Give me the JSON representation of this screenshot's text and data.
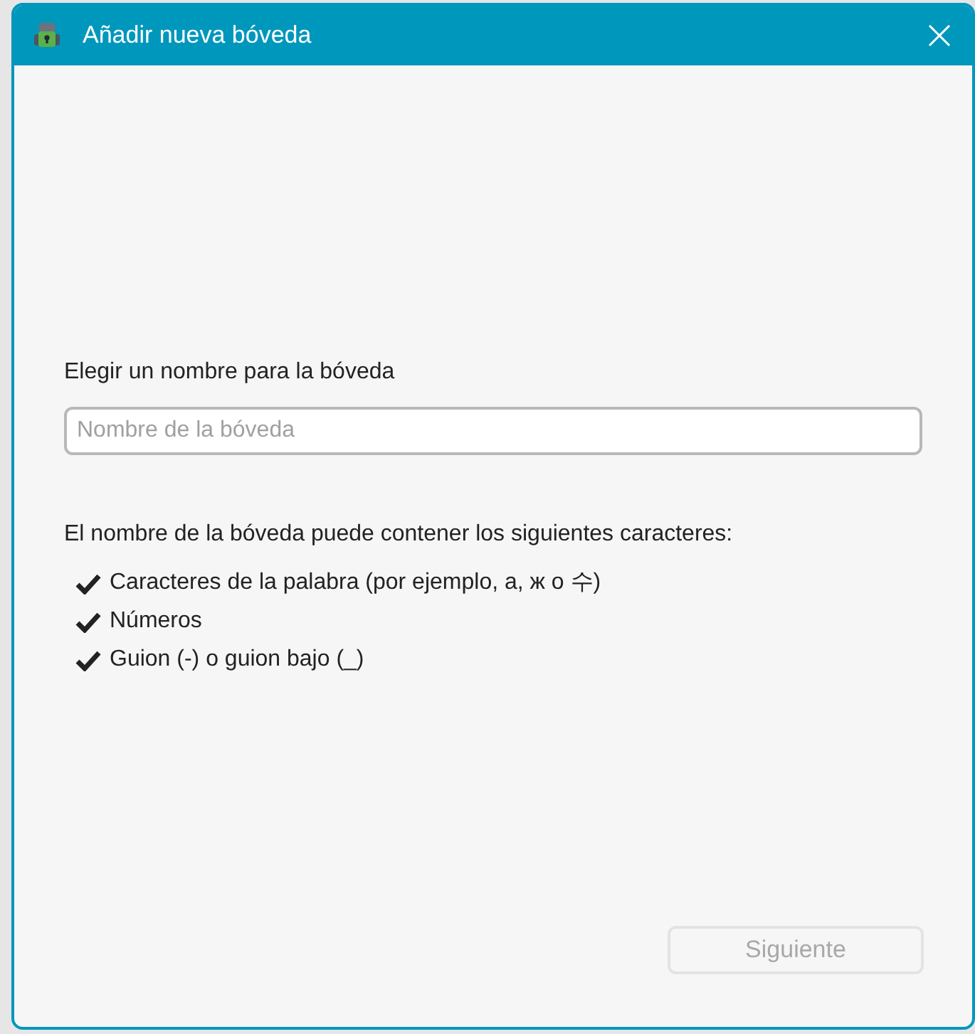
{
  "window": {
    "title": "Añadir nueva bóveda"
  },
  "name_field": {
    "label": "Elegir un nombre para la bóveda",
    "placeholder": "Nombre de la bóveda"
  },
  "rules": {
    "intro": "El nombre de la bóveda puede contener los siguientes caracteres:",
    "items": [
      "Caracteres de la palabra (por ejemplo, a, ж o 수)",
      "Números",
      "Guion (-) o guion bajo (_)"
    ]
  },
  "next_button": {
    "label": "Siguiente",
    "disabled": true
  }
}
